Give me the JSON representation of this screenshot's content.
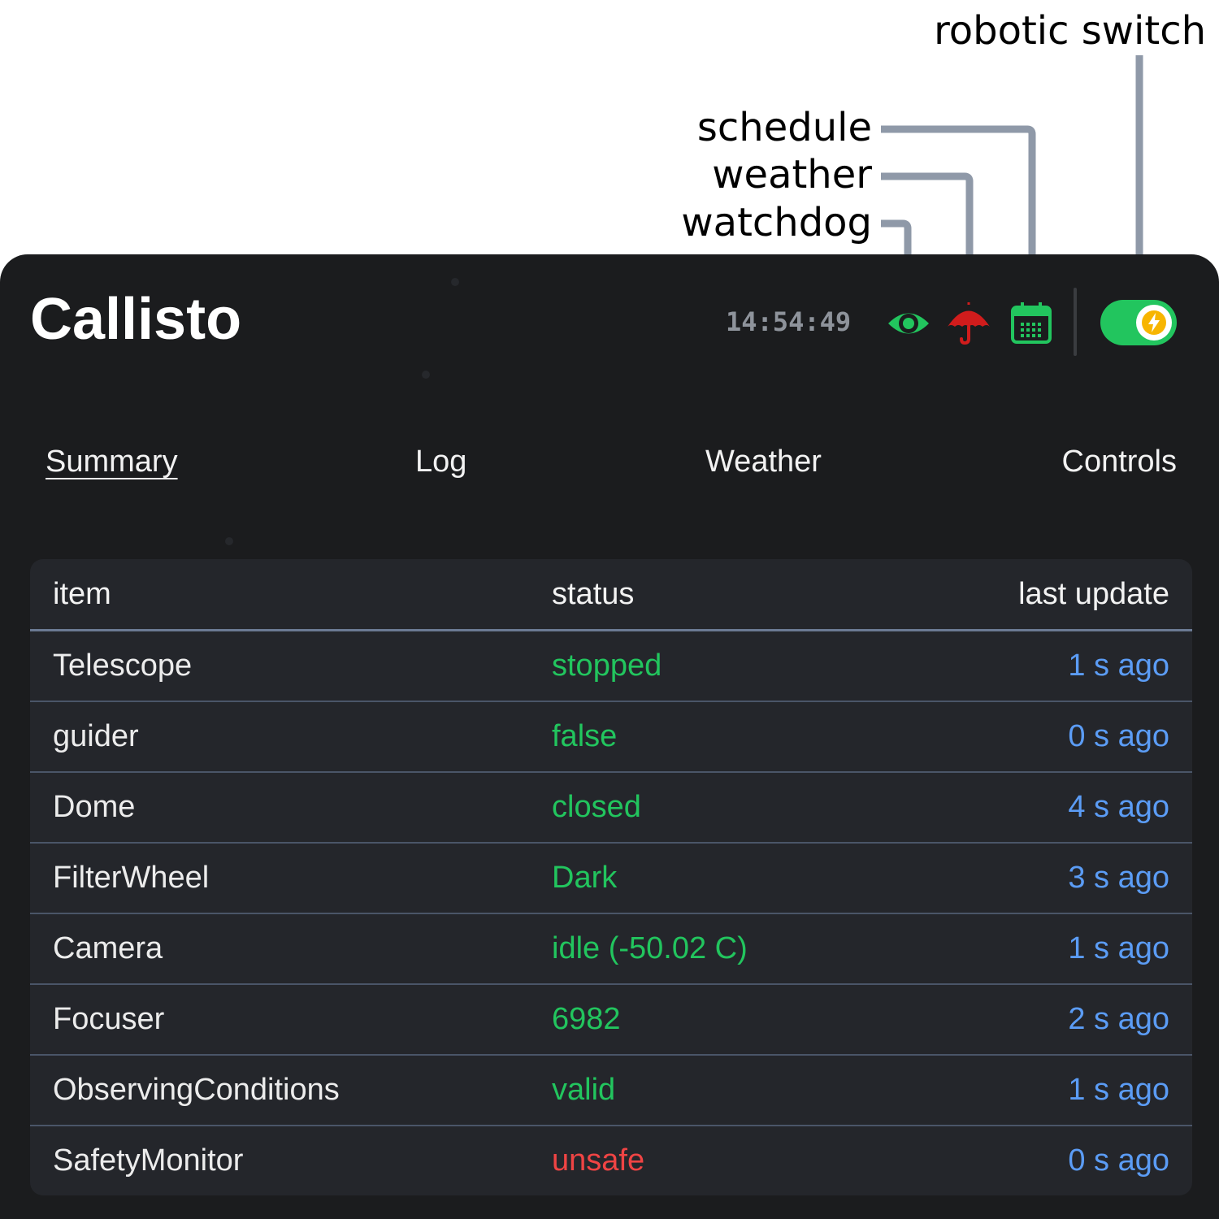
{
  "callouts": {
    "robotic_switch": "robotic switch",
    "schedule": "schedule",
    "weather": "weather",
    "watchdog": "watchdog"
  },
  "header": {
    "title": "Callisto",
    "clock": "14:54:49",
    "icons": {
      "watchdog": "eye-icon",
      "weather": "umbrella-icon",
      "schedule": "calendar-icon",
      "robotic": "bolt-icon"
    },
    "robotic_switch_on": true
  },
  "tabs": [
    {
      "label": "Summary",
      "active": true
    },
    {
      "label": "Log",
      "active": false
    },
    {
      "label": "Weather",
      "active": false
    },
    {
      "label": "Controls",
      "active": false
    }
  ],
  "table": {
    "columns": [
      "item",
      "status",
      "last update"
    ],
    "rows": [
      {
        "item": "Telescope",
        "status": "stopped",
        "state": "ok",
        "last_update": "1 s ago"
      },
      {
        "item": "guider",
        "status": "false",
        "state": "ok",
        "last_update": "0 s ago"
      },
      {
        "item": "Dome",
        "status": "closed",
        "state": "ok",
        "last_update": "4 s ago"
      },
      {
        "item": "FilterWheel",
        "status": "Dark",
        "state": "ok",
        "last_update": "3 s ago"
      },
      {
        "item": "Camera",
        "status": "idle (-50.02 C)",
        "state": "ok",
        "last_update": "1 s ago"
      },
      {
        "item": "Focuser",
        "status": "6982",
        "state": "ok",
        "last_update": "2 s ago"
      },
      {
        "item": "ObservingConditions",
        "status": "valid",
        "state": "ok",
        "last_update": "1 s ago"
      },
      {
        "item": "SafetyMonitor",
        "status": "unsafe",
        "state": "bad",
        "last_update": "0 s ago"
      }
    ]
  },
  "colors": {
    "panel_bg": "#1b1c1e",
    "table_bg": "#24262b",
    "ok": "#22c55e",
    "bad": "#ef4444",
    "time_blue": "#5b9cf5",
    "watchdog_icon": "#22c55e",
    "weather_icon": "#d11c1c",
    "schedule_icon": "#22c55e",
    "callout_line": "#8f99a8"
  }
}
